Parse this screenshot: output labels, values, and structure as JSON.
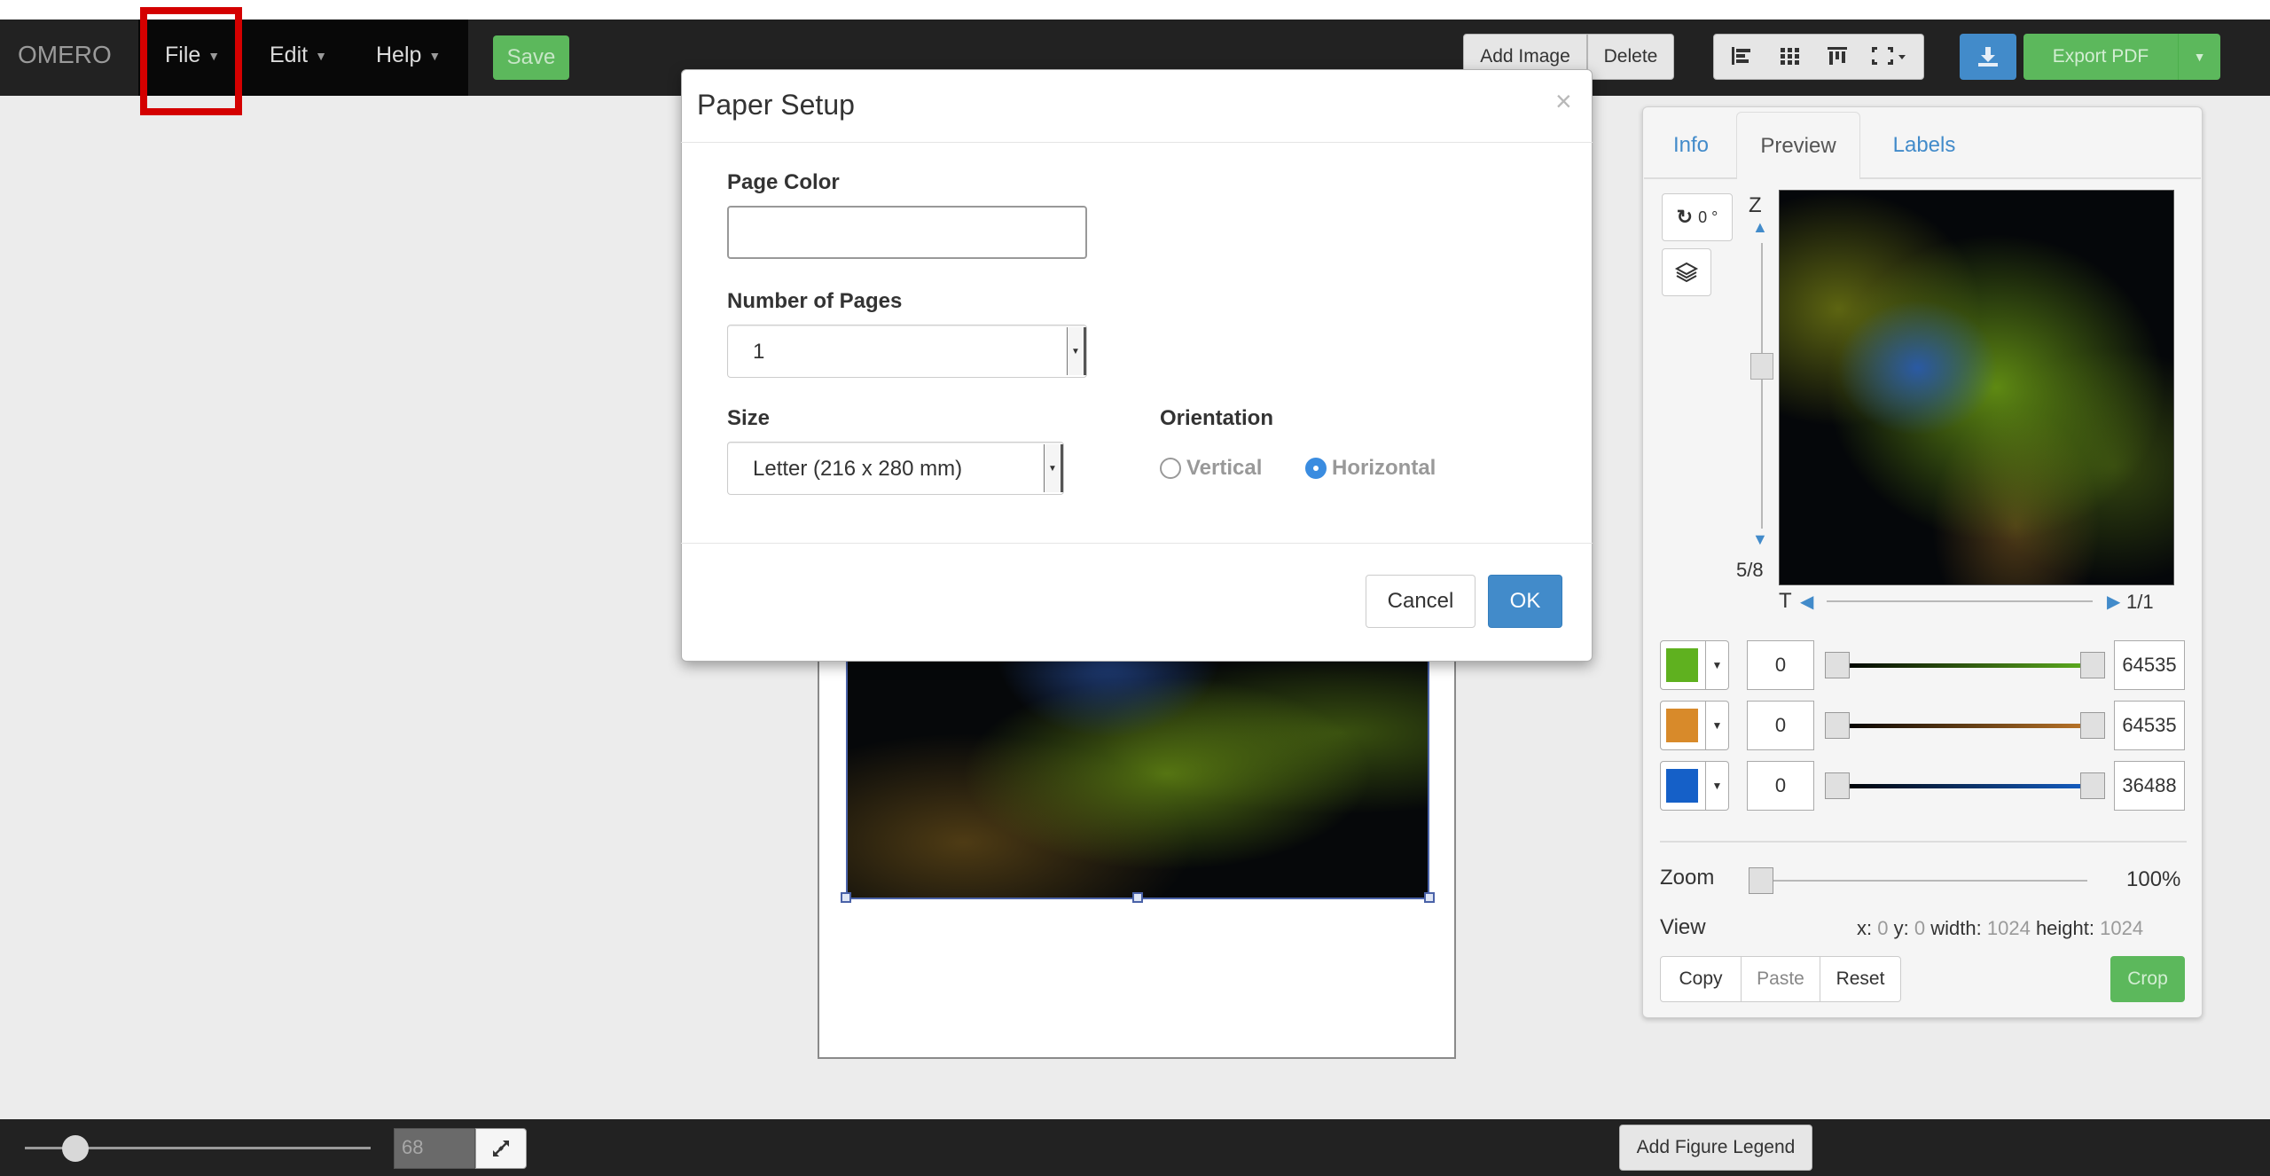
{
  "navbar": {
    "brand": "OMERO",
    "menus": [
      {
        "label": "File"
      },
      {
        "label": "Edit"
      },
      {
        "label": "Help"
      }
    ],
    "save_label": "Save",
    "add_image_label": "Add Image",
    "delete_label": "Delete",
    "export_label": "Export PDF",
    "highlight_color": "#d40000"
  },
  "dialog": {
    "title": "Paper Setup",
    "close_glyph": "×",
    "page_color_label": "Page Color",
    "page_color_value": "",
    "num_pages_label": "Number of Pages",
    "num_pages_value": "1",
    "size_label": "Size",
    "size_value": "Letter (216 x 280 mm)",
    "orientation_label": "Orientation",
    "orientation_options": [
      "Vertical",
      "Horizontal"
    ],
    "orientation_selected": "Horizontal",
    "cancel_label": "Cancel",
    "ok_label": "OK"
  },
  "panel": {
    "tabs": [
      "Info",
      "Preview",
      "Labels"
    ],
    "active_tab": "Preview",
    "rotation": "0 °",
    "z_label": "Z",
    "z_count": "5/8",
    "t_label": "T",
    "t_count": "1/1",
    "channels": [
      {
        "color": "#5fb11f",
        "min": "0",
        "max": "64535",
        "track_color": "#5fb11f"
      },
      {
        "color": "#d88a2a",
        "min": "0",
        "max": "64535",
        "track_color": "#c0782a"
      },
      {
        "color": "#1560c8",
        "min": "0",
        "max": "36488",
        "track_color": "#1560c8"
      }
    ],
    "zoom_label": "Zoom",
    "zoom_value": "100%",
    "view_label": "View",
    "view": {
      "x_label": "x:",
      "x": "0",
      "y_label": "y:",
      "y": "0",
      "width_label": "width:",
      "width": "1024",
      "height_label": "height:",
      "height": "1024"
    },
    "copy_label": "Copy",
    "paste_label": "Paste",
    "reset_label": "Reset",
    "crop_label": "Crop"
  },
  "bottombar": {
    "zoom_input_value": "68",
    "legend_label": "Add Figure Legend"
  }
}
